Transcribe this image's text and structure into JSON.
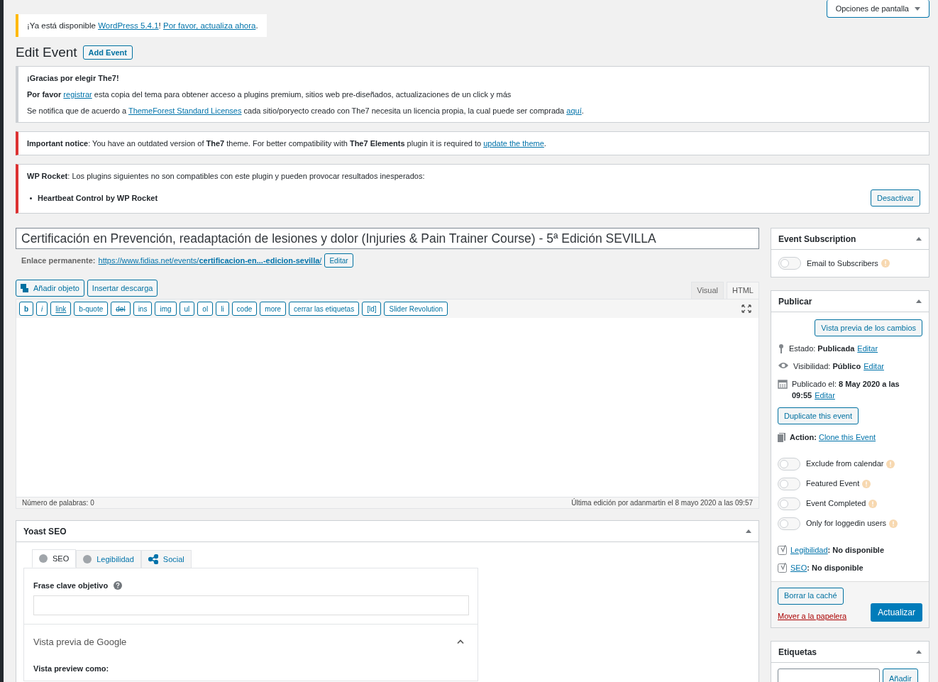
{
  "screen_options": {
    "label": "Opciones de pantalla"
  },
  "update_notice": [
    {
      "kind": "plain",
      "text": "¡Ya está disponible "
    },
    {
      "kind": "link",
      "text": "WordPress 5.4.1"
    },
    {
      "kind": "plain",
      "text": "! "
    },
    {
      "kind": "link",
      "text": "Por favor, actualiza ahora"
    },
    {
      "kind": "plain",
      "text": "."
    }
  ],
  "page_title": "Edit Event",
  "add_button": "Add Event",
  "notices": [
    {
      "kind": "info",
      "paragraphs": [
        [
          {
            "kind": "bold",
            "text": "¡Gracias por elegir The7!"
          }
        ],
        [
          {
            "kind": "bold",
            "text": "Por favor "
          },
          {
            "kind": "link",
            "text": "registrar"
          },
          {
            "kind": "plain",
            "text": " esta copia del tema para obtener acceso a plugins premium, sitios web pre-diseñados, actualizaciones de un click y más"
          }
        ],
        [
          {
            "kind": "plain",
            "text": "Se notifica que de acuerdo a "
          },
          {
            "kind": "link",
            "text": "ThemeForest Standard Licenses"
          },
          {
            "kind": "plain",
            "text": " cada sitio/poryecto creado con The7 necesita un licencia propia, la cual puede ser comprada "
          },
          {
            "kind": "link",
            "text": "aquí"
          },
          {
            "kind": "plain",
            "text": "."
          }
        ]
      ]
    },
    {
      "kind": "error",
      "paragraphs": [
        [
          {
            "kind": "bold",
            "text": "Important notice"
          },
          {
            "kind": "plain",
            "text": ": You have an outdated version of "
          },
          {
            "kind": "bold",
            "text": "The7"
          },
          {
            "kind": "plain",
            "text": " theme. For better compatibility with "
          },
          {
            "kind": "bold",
            "text": "The7 Elements"
          },
          {
            "kind": "plain",
            "text": " plugin it is required to "
          },
          {
            "kind": "link",
            "text": "update the theme"
          },
          {
            "kind": "plain",
            "text": "."
          }
        ]
      ]
    },
    {
      "kind": "error",
      "paragraphs": [
        [
          {
            "kind": "bold",
            "text": "WP Rocket"
          },
          {
            "kind": "plain",
            "text": ": Los plugins siguientes no son compatibles con este plugin y pueden provocar resultados inesperados:"
          }
        ]
      ],
      "list": [
        "Heartbeat Control by WP Rocket"
      ],
      "button": "Desactivar"
    }
  ],
  "title_value": "Certificación en Prevención, readaptación de lesiones y dolor (Injuries & Pain Trainer Course) - 5ª Edición SEVILLA",
  "permalink": {
    "label": "Enlace permanente:",
    "url": [
      {
        "kind": "plain",
        "text": "https://www.fidias.net/events/"
      },
      {
        "kind": "bold",
        "text": "certificacion-en...-edicion-sevilla"
      },
      {
        "kind": "plain",
        "text": "/"
      }
    ],
    "button": "Editar"
  },
  "media_buttons": [
    {
      "label": "Añadir objeto",
      "kind": "media"
    },
    {
      "label": "Insertar descarga",
      "kind": "plain"
    }
  ],
  "editor_tabs": [
    {
      "label": "Visual",
      "selected": false
    },
    {
      "label": "HTML",
      "selected": true
    }
  ],
  "quicktags": [
    {
      "label": "b",
      "kind": "bold"
    },
    {
      "label": "i",
      "kind": "italic"
    },
    {
      "label": "link",
      "kind": "underline"
    },
    {
      "label": "b-quote",
      "kind": "plain"
    },
    {
      "label": "del",
      "kind": "strike"
    },
    {
      "label": "ins",
      "kind": "plain"
    },
    {
      "label": "img",
      "kind": "plain"
    },
    {
      "label": "ul",
      "kind": "plain"
    },
    {
      "label": "ol",
      "kind": "plain"
    },
    {
      "label": "li",
      "kind": "plain"
    },
    {
      "label": "code",
      "kind": "plain"
    },
    {
      "label": "more",
      "kind": "plain"
    },
    {
      "label": "cerrar las etiquetas",
      "kind": "plain"
    },
    {
      "label": "[ld]",
      "kind": "plain"
    },
    {
      "label": "Slider Revolution",
      "kind": "plain"
    }
  ],
  "editor_status": {
    "word_count": "Número de palabras: 0",
    "last_edit": "Última edición por adanmartin el 8 mayo 2020 a las 09:57"
  },
  "yoast": {
    "title": "Yoast SEO",
    "tabs": [
      {
        "label": "SEO",
        "selected": true
      },
      {
        "label": "Legibilidad",
        "selected": false
      },
      {
        "label": "Social",
        "selected": false
      }
    ],
    "keyphrase_label": "Frase clave objetivo",
    "google_preview": "Vista previa de Google",
    "preview_as": "Vista preview como:"
  },
  "subscription": {
    "title": "Event Subscription",
    "toggles": [
      {
        "label": "Email to Subscribers",
        "on": false
      }
    ]
  },
  "publish": {
    "title": "Publicar",
    "preview_button": "Vista previa de los cambios",
    "rows": [
      [
        {
          "kind": "plain",
          "text": "Estado: "
        },
        {
          "kind": "bold",
          "text": "Publicada"
        },
        {
          "kind": "link",
          "text": "Editar"
        }
      ],
      [
        {
          "kind": "plain",
          "text": "Visibilidad: "
        },
        {
          "kind": "bold",
          "text": "Público"
        },
        {
          "kind": "link",
          "text": "Editar"
        }
      ],
      [
        {
          "kind": "plain",
          "text": "Publicado el: "
        },
        {
          "kind": "bold",
          "text": "8 May 2020 a las 09:55"
        },
        {
          "kind": "link",
          "text": "Editar"
        }
      ]
    ],
    "duplicate_button": "Duplicate this event",
    "action": [
      {
        "kind": "bold",
        "text": "Action: "
      },
      {
        "kind": "link",
        "text": "Clone this Event"
      }
    ],
    "toggles": [
      {
        "label": "Exclude from calendar",
        "on": false
      },
      {
        "label": "Featured Event",
        "on": false
      },
      {
        "label": "Event Completed",
        "on": false
      },
      {
        "label": "Only for loggedin users",
        "on": false
      }
    ],
    "yoast_rows": [
      [
        {
          "kind": "link",
          "text": "Legibilidad"
        },
        {
          "kind": "bold",
          "text": ": No disponible"
        }
      ],
      [
        {
          "kind": "link",
          "text": "SEO"
        },
        {
          "kind": "bold",
          "text": ": No disponible"
        }
      ]
    ],
    "cache_button": "Borrar la caché",
    "trash_link": "Mover a la papelera",
    "update_button": "Actualizar"
  },
  "tags": {
    "title": "Etiquetas",
    "add_button": "Añadir"
  }
}
